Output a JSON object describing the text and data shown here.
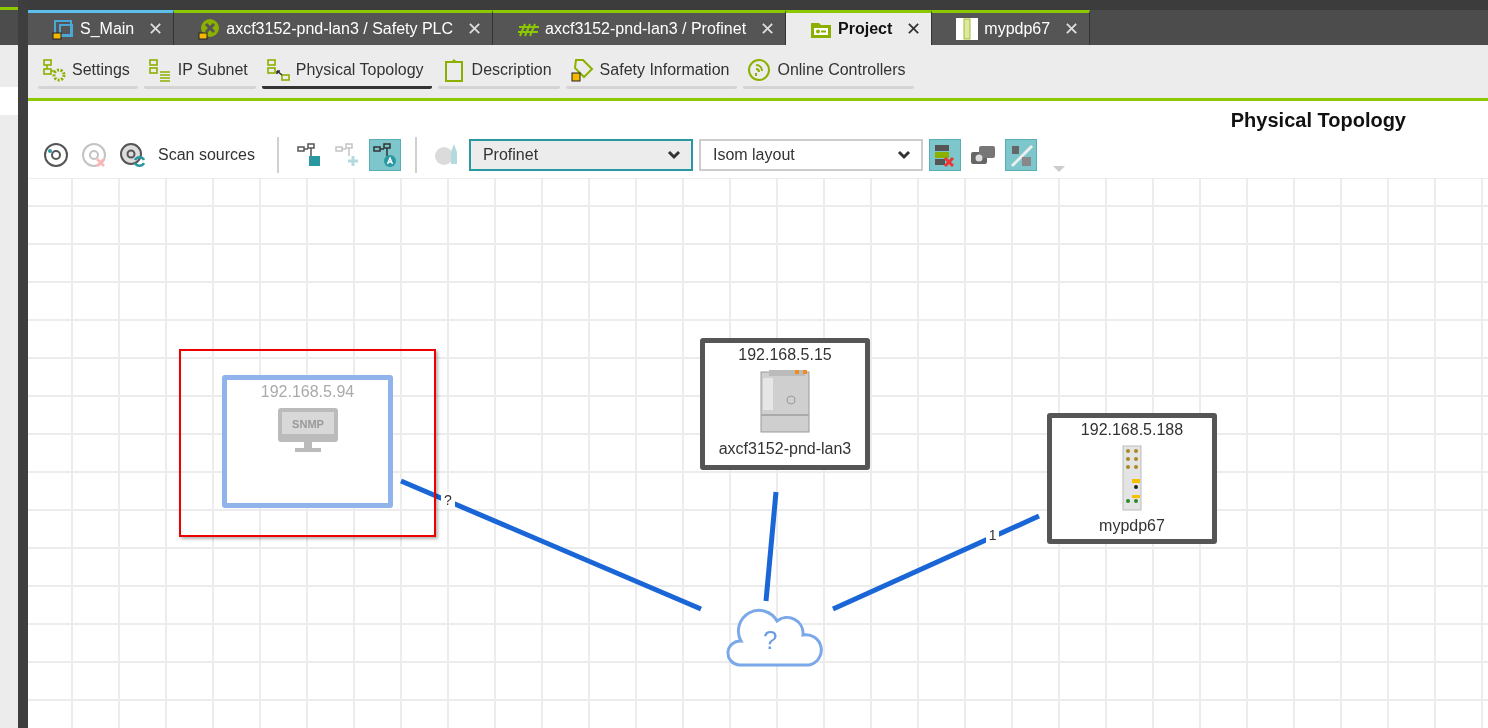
{
  "tabs": [
    {
      "label": "S_Main",
      "selected": false,
      "kind": "screen",
      "color": "#5bc0eb",
      "close": "✕"
    },
    {
      "label": "axcf3152-pnd-lan3 / Safety PLC",
      "selected": false,
      "kind": "safety",
      "color": "#8cc800",
      "close": "✕"
    },
    {
      "label": "axcf3152-pnd-lan3 / Profinet",
      "selected": false,
      "kind": "profinet",
      "color": "#8cc800",
      "close": "✕"
    },
    {
      "label": "Project",
      "selected": true,
      "kind": "project",
      "color": "#8cc800",
      "close": "✕"
    },
    {
      "label": "mypdp67",
      "selected": false,
      "kind": "device",
      "color": "#8cc800",
      "close": "✕"
    }
  ],
  "subtabs": [
    {
      "label": "Settings",
      "selected": false
    },
    {
      "label": "IP Subnet",
      "selected": false
    },
    {
      "label": "Physical Topology",
      "selected": true
    },
    {
      "label": "Description",
      "selected": false
    },
    {
      "label": "Safety Information",
      "selected": false
    },
    {
      "label": "Online Controllers",
      "selected": false
    }
  ],
  "page_title": "Physical Topology",
  "toolbar": [
    {
      "kind": "icon",
      "disabled": false,
      "on": false
    },
    {
      "kind": "icon",
      "disabled": true,
      "on": false
    },
    {
      "kind": "icon",
      "disabled": false,
      "on": false
    },
    {
      "kind": "text",
      "label": "Scan sources"
    },
    {
      "kind": "separator"
    },
    {
      "kind": "icon",
      "disabled": false,
      "on": false
    },
    {
      "kind": "icon",
      "disabled": true,
      "on": false
    },
    {
      "kind": "icon",
      "disabled": false,
      "on": true
    },
    {
      "kind": "separator"
    },
    {
      "kind": "icon",
      "disabled": true,
      "on": false
    },
    {
      "kind": "dropdown",
      "value": "Profinet",
      "focused": true
    },
    {
      "kind": "dropdown",
      "value": "Isom layout",
      "focused": false
    },
    {
      "kind": "icon",
      "disabled": false,
      "on": true
    },
    {
      "kind": "icon",
      "disabled": false,
      "on": false
    },
    {
      "kind": "icon",
      "disabled": false,
      "on": true
    },
    {
      "kind": "overflow"
    }
  ],
  "nodes": [
    {
      "kind": "snmp",
      "ip": "192.168.5.94",
      "screen_text": "SNMP",
      "selected": true,
      "disabled": true
    },
    {
      "kind": "plc",
      "ip": "192.168.5.15",
      "name": "axcf3152-pnd-lan3",
      "selected": false,
      "disabled": false
    },
    {
      "kind": "io",
      "ip": "192.168.5.188",
      "name": "mypdp67",
      "selected": false,
      "disabled": false
    }
  ],
  "cloud": {
    "label": "?"
  },
  "links": [
    {
      "kind": "labelled",
      "label": "?"
    },
    {
      "kind": "plain"
    },
    {
      "kind": "labelled",
      "label": "1"
    }
  ]
}
